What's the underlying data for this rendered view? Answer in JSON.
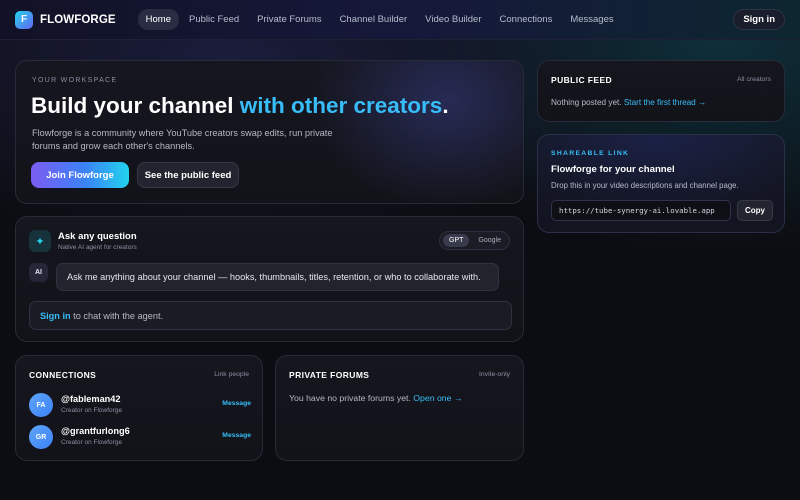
{
  "app": {
    "logo_letter": "F",
    "name": "FLOWFORGE"
  },
  "nav": {
    "links": [
      "Home",
      "Public Feed",
      "Private Forums",
      "Channel Builder",
      "Video Builder",
      "Connections",
      "Messages"
    ],
    "active": "Home",
    "signin_label": "Sign in"
  },
  "hero": {
    "eyebrow": "YOUR WORKSPACE",
    "title_main": "Build your channel ",
    "title_accent": "with other creators",
    "title_end": ".",
    "description": "Flowforge is a community where YouTube creators swap edits, run private forums and grow each other's channels.",
    "primary_button": "Join Flowforge",
    "secondary_button": "See the public feed"
  },
  "ask": {
    "icon": "sparkle-icon",
    "title": "Ask any question",
    "subtitle": "Native AI agent for creators",
    "models": [
      "GPT",
      "Google"
    ],
    "active_model": "GPT",
    "ai_badge": "AI",
    "ai_message": "Ask me anything about your channel — hooks, thumbnails, titles, retention, or who to collaborate with.",
    "signin_link": "Sign in",
    "signin_text": " to chat with the agent."
  },
  "connections": {
    "title": "CONNECTIONS",
    "meta": "Link people",
    "people": [
      {
        "initials": "FA",
        "handle": "@fableman42",
        "role": "Creator on Flowforge",
        "action": "Message"
      },
      {
        "initials": "GR",
        "handle": "@grantfurlong6",
        "role": "Creator on Flowforge",
        "action": "Message"
      }
    ]
  },
  "forums": {
    "title": "PRIVATE FORUMS",
    "meta": "Invite-only",
    "empty_text": "You have no private forums yet. ",
    "empty_link": "Open one →"
  },
  "feed": {
    "title": "PUBLIC FEED",
    "meta": "All creators",
    "empty_text": "Nothing posted yet. ",
    "empty_link": "Start the first thread →"
  },
  "share": {
    "eyebrow": "SHAREABLE LINK",
    "title": "Flowforge for your channel",
    "description": "Drop this in your video descriptions and channel page.",
    "url": "https://tube-synergy-ai.lovable.app",
    "copy_label": "Copy"
  },
  "colors": {
    "accent": "#38bdf8",
    "primary_gradient_start": "#7c5cf2",
    "primary_gradient_end": "#22d3ee",
    "background": "#0c0d12"
  }
}
